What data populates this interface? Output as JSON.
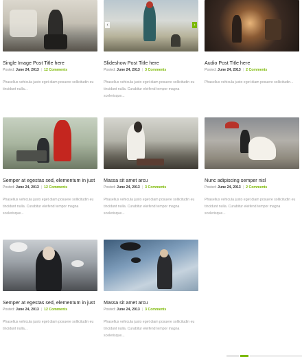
{
  "posts": [
    {
      "title": "Single Image Post Title here",
      "posted_label": "Posted:",
      "date": "June 24, 2013",
      "separator": "|",
      "comments": "12 Comments",
      "excerpt": "Phasellus vehicula justo eget diam posuere sollicitudin eu tincidunt nulla..."
    },
    {
      "title": "Slideshow Post Title here",
      "posted_label": "Posted:",
      "date": "June 24, 2013",
      "separator": "|",
      "comments": "3 Comments",
      "excerpt": "Phasellus vehicula justo eget diam posuere sollicitudin eu tincidunt nulla. Curabitur eleifend tempor magna scelerisque..."
    },
    {
      "title": "Audio Post Title here",
      "posted_label": "Posted:",
      "date": "June 24, 2013",
      "separator": "|",
      "comments": "2 Comments",
      "excerpt": "Phasellus vehicula justo eget diam posuere sollicitudin..."
    },
    {
      "title": "Semper at egestas sed, elementum in just",
      "posted_label": "Posted:",
      "date": "June 24, 2013",
      "separator": "|",
      "comments": "12 Comments",
      "excerpt": "Phasellus vehicula justo eget diam posuere sollicitudin eu tincidunt nulla. Curabitur eleifend tempor magna scelerisque..."
    },
    {
      "title": "Massa sit amet arcu",
      "posted_label": "Posted:",
      "date": "June 24, 2013",
      "separator": "|",
      "comments": "3 Comments",
      "excerpt": "Phasellus vehicula justo eget diam posuere sollicitudin eu tincidunt nulla. Curabitur eleifend tempor magna scelerisque..."
    },
    {
      "title": "Nunc adipiscing semper nisl",
      "posted_label": "Posted:",
      "date": "June 24, 2013",
      "separator": "|",
      "comments": "2 Comments",
      "excerpt": "Phasellus vehicula justo eget diam posuere sollicitudin eu tincidunt nulla. Curabitur eleifend tempor magna scelerisque..."
    },
    {
      "title": "Semper at egestas sed, elementum in just",
      "posted_label": "Posted:",
      "date": "June 24, 2013",
      "separator": "|",
      "comments": "12 Comments",
      "excerpt": "Phasellus vehicula justo eget diam posuere sollicitudin eu tincidunt nulla..."
    },
    {
      "title": "Massa sit amet arcu",
      "posted_label": "Posted:",
      "date": "June 24, 2013",
      "separator": "|",
      "comments": "3 Comments",
      "excerpt": "Phasellus vehicula justo eget diam posuere sollicitudin eu tincidunt nulla. Curabitur eleifend tempor magna scelerisque..."
    }
  ],
  "slideshow_controls": {
    "prev_icon": "chevron-left-icon",
    "next_icon": "chevron-right-icon"
  },
  "colors": {
    "accent": "#7ab800",
    "title": "#222222",
    "meta": "#888888",
    "excerpt": "#999999"
  }
}
